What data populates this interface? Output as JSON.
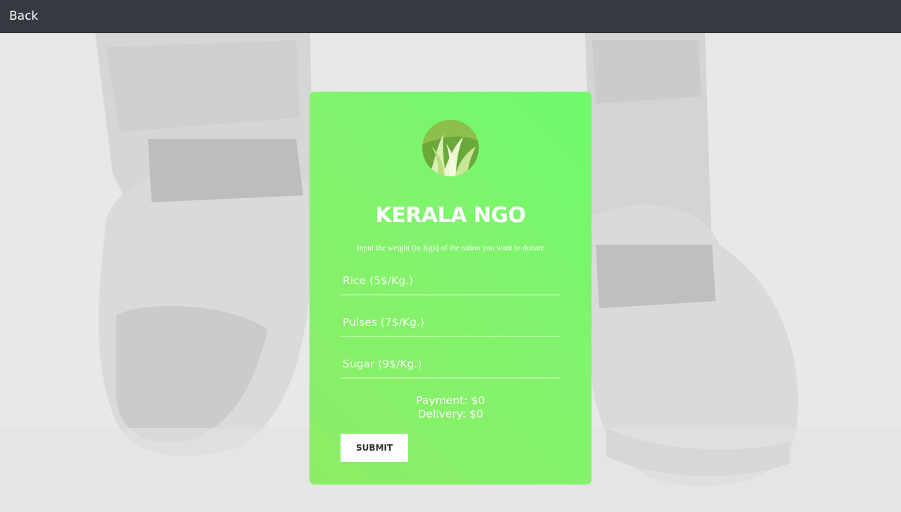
{
  "topbar": {
    "back_label": "Back"
  },
  "card": {
    "title": "KERALA NGO",
    "subtitle": "Input the weight (in Kgs) of the ration you want to donate",
    "fields": [
      {
        "placeholder": "Rice (5$/Kg.)",
        "value": ""
      },
      {
        "placeholder": "Pulses (7$/Kg.)",
        "value": ""
      },
      {
        "placeholder": "Sugar (9$/Kg.)",
        "value": ""
      }
    ],
    "payment_text": "Payment: $0",
    "delivery_text": "Delivery: $0",
    "submit_label": "SUBMIT"
  },
  "icons": {
    "logo": "grass-leaf-logo-icon"
  },
  "colors": {
    "topbar": "#343a40",
    "card_green": "#7ef36c",
    "logo_green": "#72b03a"
  }
}
